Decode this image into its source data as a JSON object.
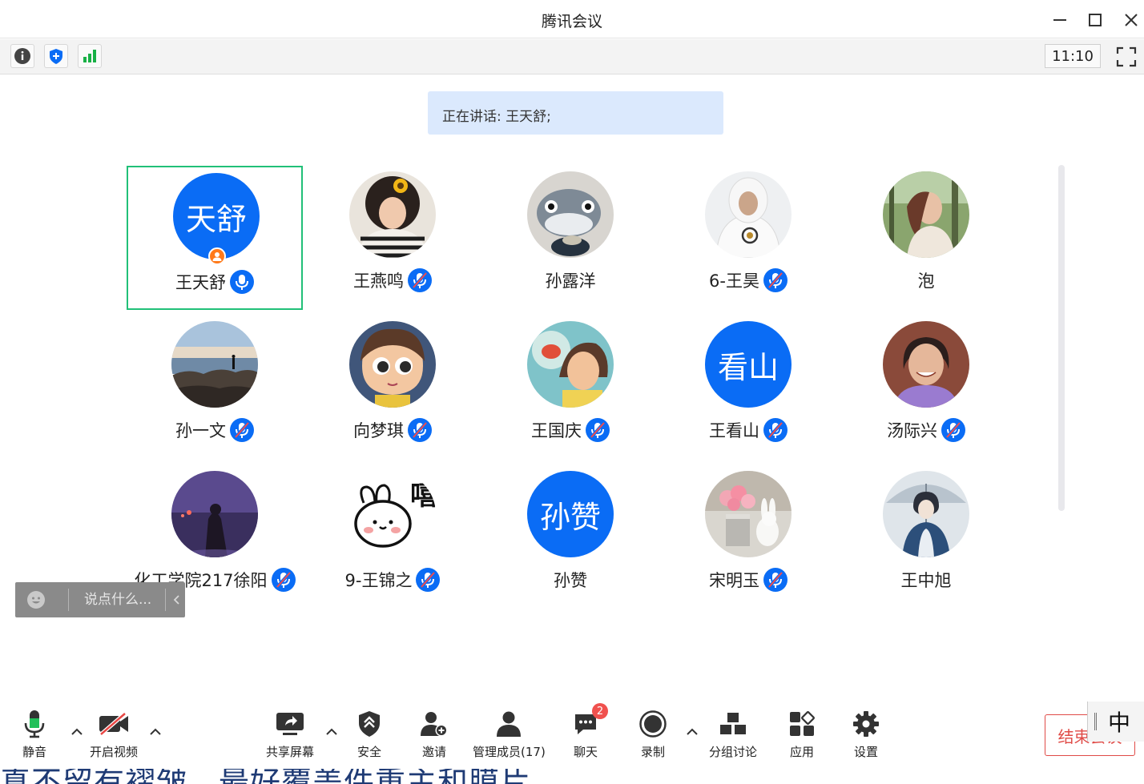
{
  "window": {
    "title": "腾讯会议"
  },
  "infobar": {
    "clock": "11:10"
  },
  "speaking": {
    "text": "正在讲话: 王天舒;"
  },
  "participants": [
    {
      "name": "王天舒",
      "avatar_text": "天舒",
      "mic": "on",
      "host": true,
      "active": true
    },
    {
      "name": "王燕鸣",
      "avatar": "photo-curly-hair-striped",
      "mic": "muted"
    },
    {
      "name": "孙露洋",
      "avatar": "photo-plush-fish",
      "mic": "none"
    },
    {
      "name": "6-王昊",
      "avatar": "photo-white-hoodie",
      "mic": "muted"
    },
    {
      "name": "泡",
      "avatar": "photo-girl-in-forest",
      "mic": "none"
    },
    {
      "name": "孙一文",
      "avatar": "photo-seaside-rocks",
      "mic": "muted"
    },
    {
      "name": "向梦琪",
      "avatar": "photo-cartoon-boy",
      "mic": "muted"
    },
    {
      "name": "王国庆",
      "avatar": "photo-anime-boy-fish",
      "mic": "muted"
    },
    {
      "name": "王看山",
      "avatar_text": "看山",
      "mic": "muted"
    },
    {
      "name": "汤际兴",
      "avatar": "photo-smiling-woman",
      "mic": "muted"
    },
    {
      "name": "化工学院217徐阳",
      "avatar": "photo-purple-night",
      "mic": "muted"
    },
    {
      "name": "9-王锦之",
      "avatar": "photo-bunny-sticker",
      "mic": "muted",
      "sticker_text": "嘻"
    },
    {
      "name": "孙赞",
      "avatar_text": "孙赞",
      "mic": "none"
    },
    {
      "name": "宋明玉",
      "avatar": "photo-flowers-rabbit",
      "mic": "muted"
    },
    {
      "name": "王中旭",
      "avatar": "photo-umbrella-art",
      "mic": "none"
    }
  ],
  "chat": {
    "placeholder": "说点什么..."
  },
  "toolbar": {
    "mute": "静音",
    "video": "开启视频",
    "share": "共享屏幕",
    "security": "安全",
    "invite": "邀请",
    "members": "管理成员(17)",
    "chat": "聊天",
    "chat_badge": "2",
    "record": "录制",
    "breakout": "分组讨论",
    "apps": "应用",
    "settings": "设置",
    "end": "结束会议"
  },
  "ime": {
    "mode": "中"
  },
  "background_doc": {
    "text": "真不留有褶皱，最好覆盖件重主和膜片。"
  },
  "colors": {
    "accent": "#0a6cf5",
    "active_border": "#21c078",
    "end_red": "#e04b47",
    "speaking_bg": "#dbe9fd"
  }
}
